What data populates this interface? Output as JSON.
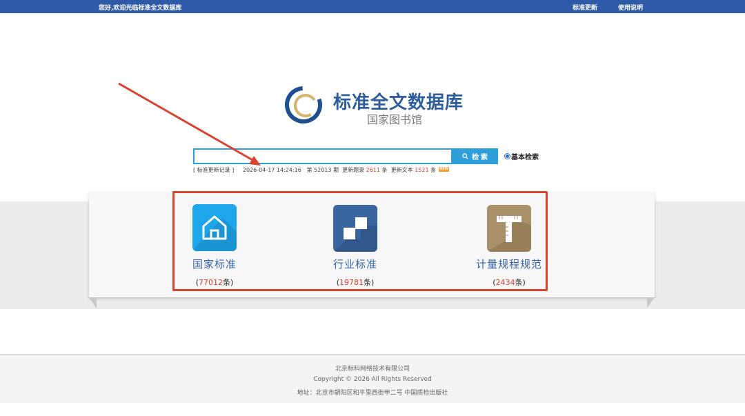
{
  "topbar": {
    "welcome": "您好,欢迎光临标准全文数据库",
    "links": [
      "标准更新",
      "使用说明"
    ]
  },
  "logo": {
    "title": "标准全文数据库",
    "subtitle": "国家图书馆"
  },
  "search": {
    "value": "",
    "button_label": "检 索",
    "radio_label": "基本检索"
  },
  "update": {
    "record_link": "[ 标准更新记录 ]",
    "timestamp": "2026-04-17 14:24:16",
    "issue_prefix": "第",
    "issue_number": "52013",
    "issue_suffix": "期",
    "titles_label": "更新题录",
    "titles_count": "2611",
    "titles_unit": "条",
    "text_label": "更新文本",
    "text_count": "1521",
    "text_unit": "条",
    "badge": "NEW"
  },
  "categories": [
    {
      "name": "国家标准",
      "open": "(",
      "count": "77012",
      "unit": "条)",
      "icon": "house-icon",
      "color": "#1ea6ea"
    },
    {
      "name": "行业标准",
      "open": "(",
      "count": "19781",
      "unit": "条)",
      "icon": "blocks-icon",
      "color": "#3a66a0"
    },
    {
      "name": "计量规程规范",
      "open": "(",
      "count": "2434",
      "unit": "条)",
      "icon": "ruler-icon",
      "color": "#a89068"
    }
  ],
  "footer": {
    "company": "北京标科网络技术有限公司",
    "copyright": "Copyright © 2026  All Rights Reserved",
    "address": "地址：北京市朝阳区和平里西街甲二号 中国质检出版社"
  },
  "colors": {
    "topbar": "#2f5aa8",
    "search_accent": "#2e9fd8",
    "highlight": "#d9432f",
    "count_red": "#e03a2a"
  }
}
